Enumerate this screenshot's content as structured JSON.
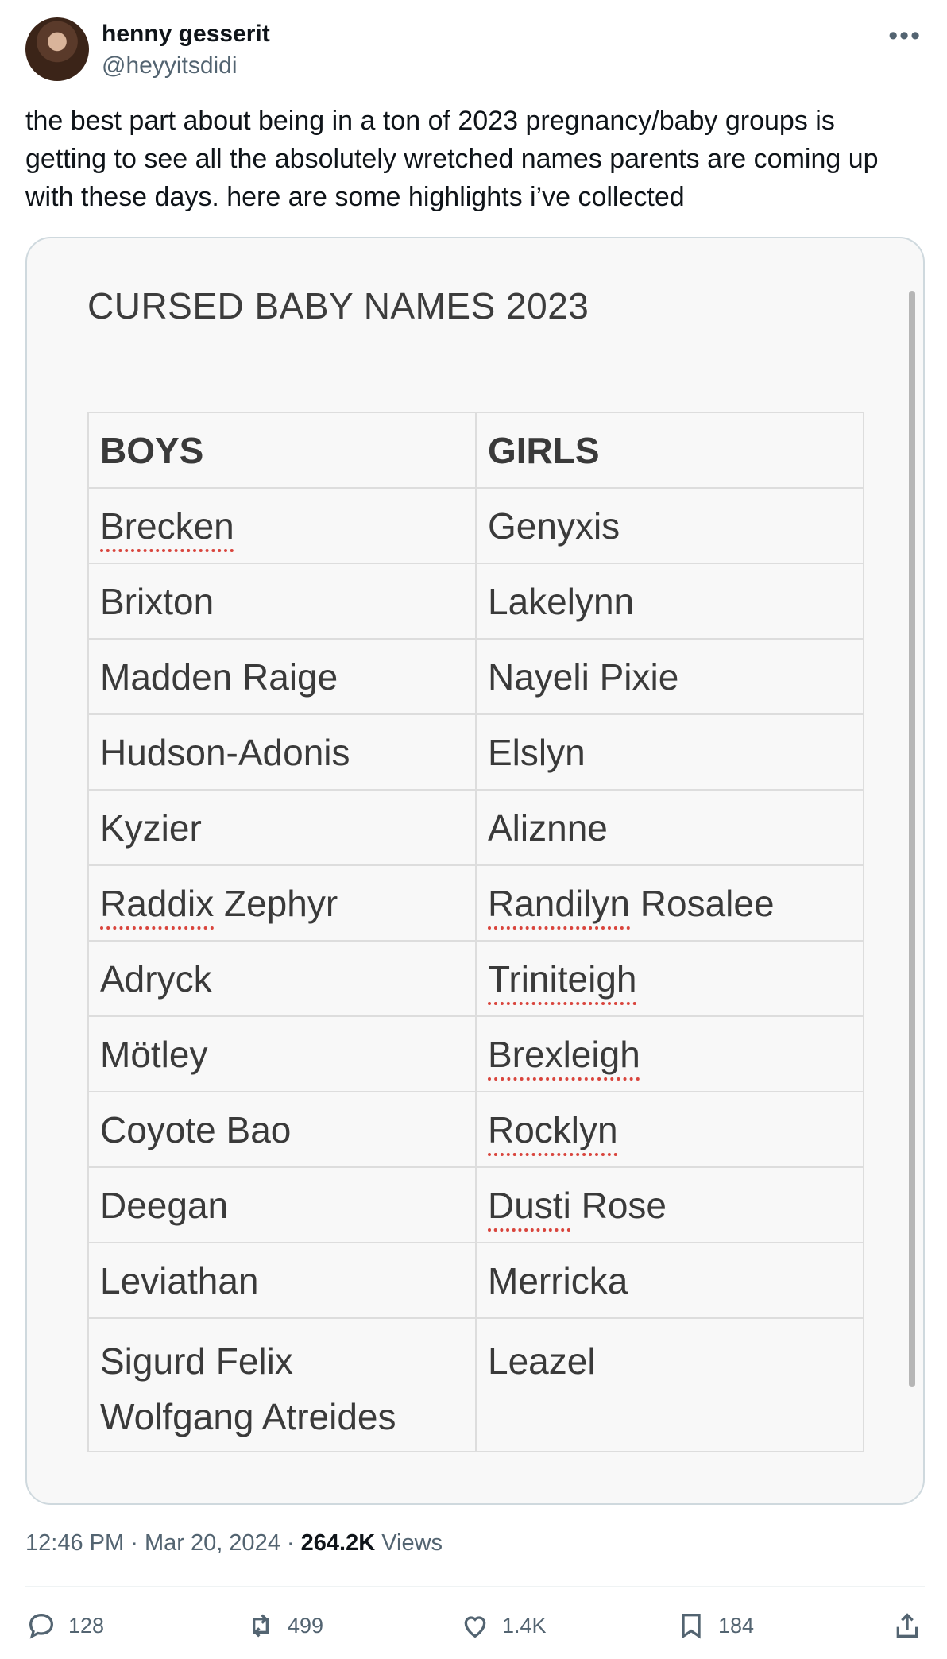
{
  "author": {
    "name": "henny gesserit",
    "handle": "@heyyitsdidi"
  },
  "tweet": {
    "text": "the best part about being in a ton of 2023 pregnancy/baby groups is getting to see all the absolutely wretched names parents are coming up with these days. here are some highlights i’ve collected"
  },
  "image": {
    "title": "CURSED BABY NAMES 2023",
    "headers": [
      "BOYS",
      "GIRLS"
    ],
    "rows": [
      [
        "Brecken",
        "Genyxis"
      ],
      [
        "Brixton",
        "Lakelynn"
      ],
      [
        "Madden Raige",
        "Nayeli Pixie"
      ],
      [
        "Hudson-Adonis",
        "Elslyn"
      ],
      [
        "Kyzier",
        "Aliznne"
      ],
      [
        "Raddix Zephyr",
        "Randilyn Rosalee"
      ],
      [
        "Adryck",
        "Triniteigh"
      ],
      [
        "Mötley",
        "Brexleigh"
      ],
      [
        "Coyote Bao",
        "Rocklyn"
      ],
      [
        "Deegan",
        "Dusti Rose"
      ],
      [
        "Leviathan",
        "Merricka"
      ]
    ],
    "last_row": {
      "boy_line1": "Sigurd Felix",
      "boy_line2": "Wolfgang Atreides",
      "girl": "Leazel"
    },
    "spellcheck_words": [
      "Brecken",
      "Raddix",
      "Randilyn",
      "Triniteigh",
      "Brexleigh",
      "Rocklyn",
      "Dusti"
    ]
  },
  "meta": {
    "time": "12:46 PM",
    "sep1": "·",
    "date": "Mar 20, 2024",
    "sep2": "·",
    "views_count": "264.2K",
    "views_label": "Views"
  },
  "actions": {
    "replies": "128",
    "reposts": "499",
    "likes": "1.4K",
    "bookmarks": "184"
  },
  "icons": {
    "more": "more-horizontal-icon",
    "reply": "reply-icon",
    "repost": "repost-icon",
    "like": "heart-icon",
    "bookmark": "bookmark-icon",
    "share": "share-icon"
  },
  "colors": {
    "text": "#0f1419",
    "secondary": "#536471",
    "border": "#cfd9de",
    "spellcheck": "#d9453d"
  }
}
